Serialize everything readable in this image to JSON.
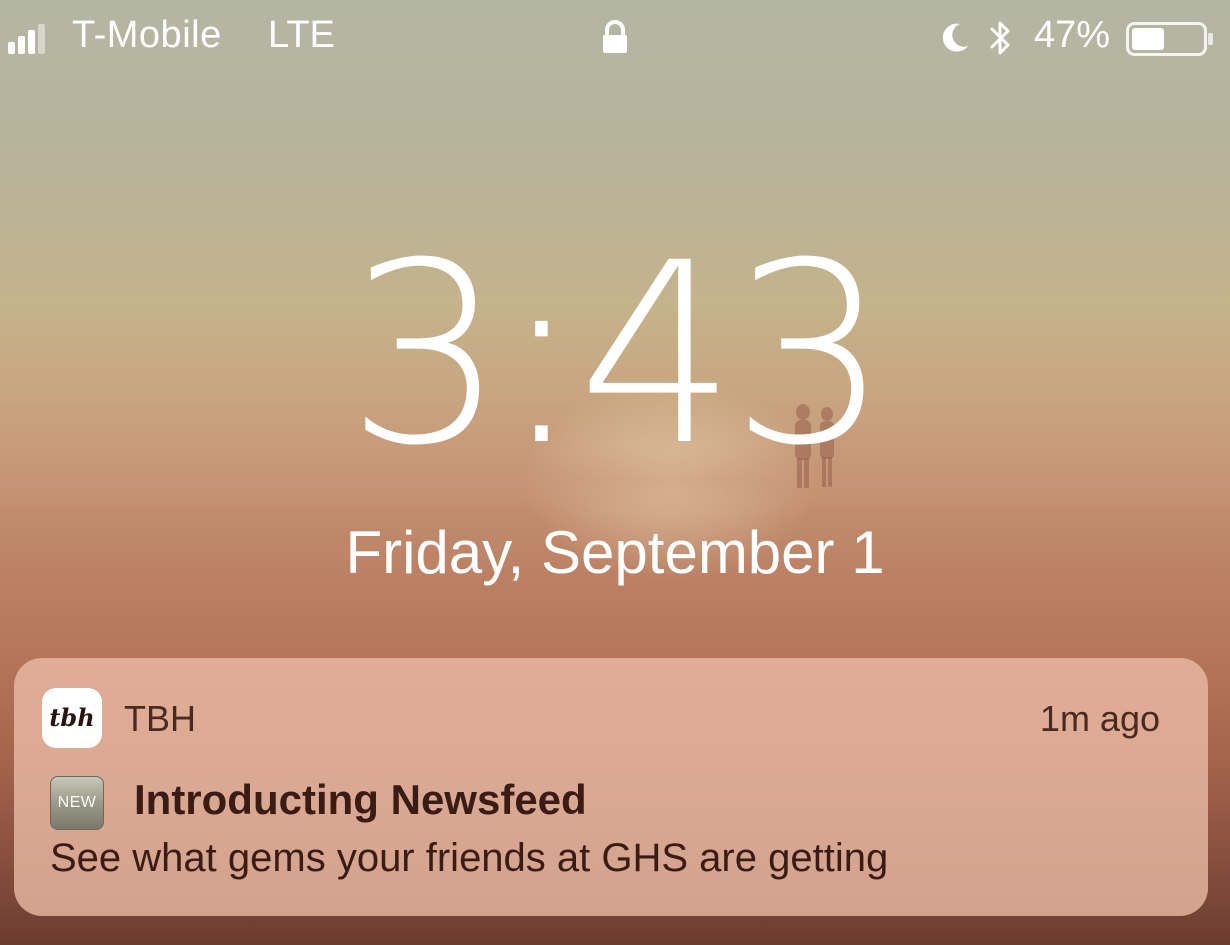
{
  "status_bar": {
    "carrier": "T-Mobile",
    "network": "LTE",
    "battery_percent": "47%",
    "battery_level": 0.47,
    "icons": [
      "signal-icon",
      "lock-icon",
      "moon-icon",
      "bluetooth-icon",
      "battery-icon"
    ]
  },
  "lock_screen": {
    "time": "3:43",
    "date": "Friday, September 1"
  },
  "notification": {
    "app_icon_text": "tbh",
    "app_name": "TBH",
    "time_ago": "1m ago",
    "emoji_text": "NEW",
    "title": "Introducting Newsfeed",
    "body": "See what gems your friends at GHS are getting"
  },
  "colors": {
    "notification_bg": "#ecbea8",
    "text_dark": "#3a1c14",
    "text_light": "#ffffff"
  }
}
